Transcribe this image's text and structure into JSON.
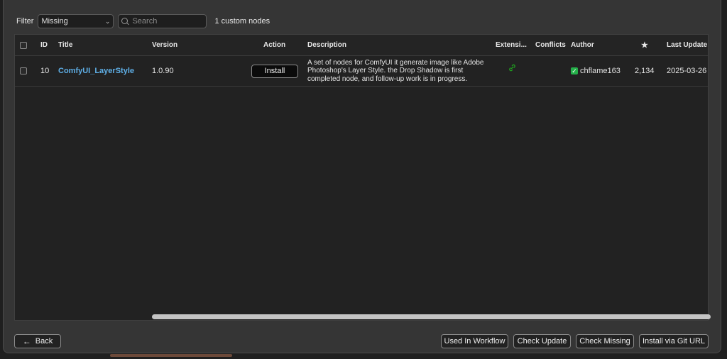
{
  "filter": {
    "label": "Filter",
    "selected": "Missing",
    "search_placeholder": "Search",
    "count_text": "1 custom nodes"
  },
  "table": {
    "headers": {
      "id": "ID",
      "title": "Title",
      "version": "Version",
      "action": "Action",
      "description": "Description",
      "extension": "Extensi...",
      "conflicts": "Conflicts",
      "author": "Author",
      "stars": "★",
      "last_update": "Last Update"
    },
    "rows": [
      {
        "id": "10",
        "title": "ComfyUI_LayerStyle",
        "version": "1.0.90",
        "action": "Install",
        "description": "A set of nodes for ComfyUI it generate image like Adobe Photoshop's Layer Style. the Drop Shadow is first completed node, and follow-up work is in progress.",
        "extension_icon": "extension-link-icon",
        "conflicts": "",
        "author": "chflame163",
        "author_verified": "✅",
        "stars": "2,134",
        "last_update": "2025-03-26"
      }
    ]
  },
  "footer": {
    "back_label": "Back",
    "used_in_workflow_label": "Used In Workflow",
    "check_update_label": "Check Update",
    "check_missing_label": "Check Missing",
    "install_git_label": "Install via Git URL"
  },
  "colors": {
    "title_link": "#5fb0e8",
    "extension_icon": "#1fa11f",
    "verified": "#25b04a"
  }
}
